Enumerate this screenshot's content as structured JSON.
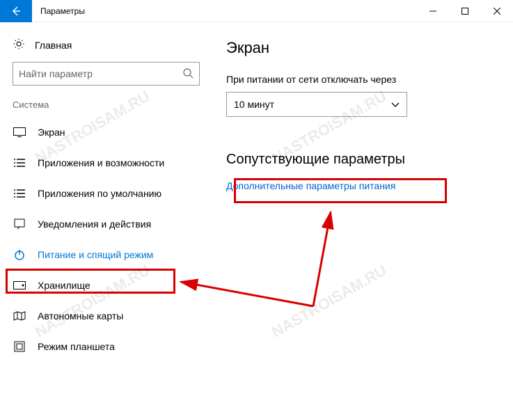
{
  "window": {
    "title": "Параметры"
  },
  "sidebar": {
    "home": "Главная",
    "search_placeholder": "Найти параметр",
    "section": "Система",
    "items": [
      {
        "label": "Экран"
      },
      {
        "label": "Приложения и возможности"
      },
      {
        "label": "Приложения по умолчанию"
      },
      {
        "label": "Уведомления и действия"
      },
      {
        "label": "Питание и спящий режим"
      },
      {
        "label": "Хранилище"
      },
      {
        "label": "Автономные карты"
      },
      {
        "label": "Режим планшета"
      }
    ]
  },
  "main": {
    "heading": "Экран",
    "plugged_label": "При питании от сети отключать через",
    "plugged_value": "10 минут",
    "related_heading": "Сопутствующие параметры",
    "related_link": "Дополнительные параметры питания"
  },
  "watermark": "NASTROISAM.RU"
}
